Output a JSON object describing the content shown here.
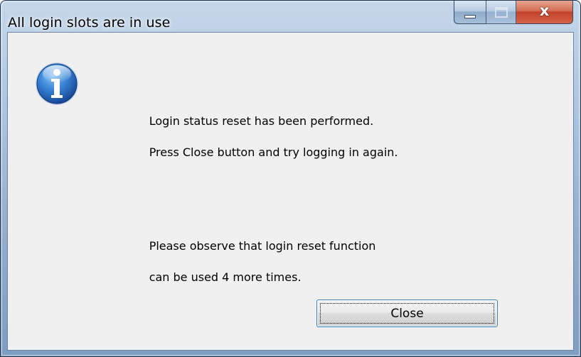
{
  "window": {
    "title": "All login slots are in use"
  },
  "caption_buttons": {
    "minimize_icon": "minimize-icon",
    "maximize_icon": "maximize-icon",
    "close_glyph": "x"
  },
  "dialog": {
    "icon": "info-icon",
    "message_lines": [
      "Login status reset has been performed.",
      "Press Close button and try logging in again.",
      "Please observe that login reset function",
      "can be used 4 more times."
    ],
    "close_button_label": "Close"
  },
  "colors": {
    "titlebar": "#a9c2dd",
    "client_background": "#f0f0f0",
    "close_caption_button": "#c4402a",
    "button_focus_border": "#3c7fb1",
    "info_icon_blue": "#1f5fb4"
  }
}
